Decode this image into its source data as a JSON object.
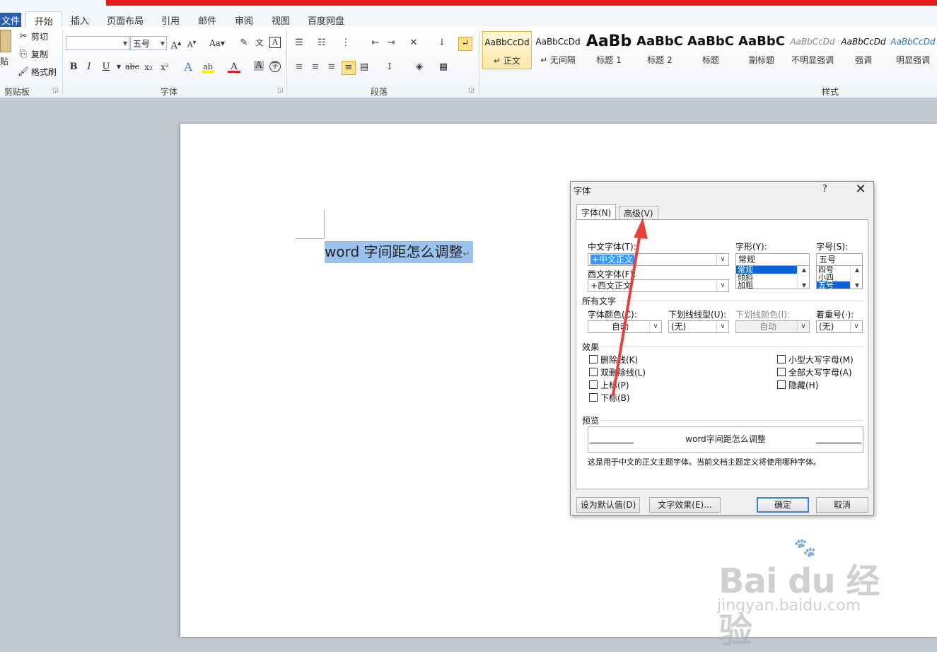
{
  "tabs": {
    "file": "文件",
    "items": [
      "开始",
      "插入",
      "页面布局",
      "引用",
      "邮件",
      "审阅",
      "视图",
      "百度网盘"
    ]
  },
  "ribbon": {
    "clipboard": {
      "paste": "贴",
      "cut": "剪切",
      "copy": "复制",
      "format_painter": "格式刷",
      "label": "剪贴板"
    },
    "font": {
      "font_name": "",
      "font_size": "五号",
      "label": "字体"
    },
    "paragraph": {
      "label": "段落"
    },
    "styles": {
      "label": "样式",
      "items": [
        {
          "sample": "AaBbCcDd",
          "name": "↵ 正文"
        },
        {
          "sample": "AaBbCcDd",
          "name": "↵ 无间隔"
        },
        {
          "sample": "AaBb",
          "name": "标题 1"
        },
        {
          "sample": "AaBbC",
          "name": "标题 2"
        },
        {
          "sample": "AaBbC",
          "name": "标题"
        },
        {
          "sample": "AaBbC",
          "name": "副标题"
        },
        {
          "sample": "AaBbCcDd",
          "name": "不明显强调"
        },
        {
          "sample": "AaBbCcDd",
          "name": "强调"
        },
        {
          "sample": "AaBbCcDd",
          "name": "明显强调"
        }
      ]
    }
  },
  "document": {
    "selected_text": "word 字间距怎么调整",
    "para_mark": "↵"
  },
  "dialog": {
    "title": "字体",
    "help": "?",
    "close": "✕",
    "tabs": [
      "字体(N)",
      "高级(V)"
    ],
    "cn_font_label": "中文字体(T):",
    "cn_font_value": "+中文正文",
    "west_font_label": "西文字体(F):",
    "west_font_value": "+西文正文",
    "style_label": "字形(Y):",
    "style_value": "常规",
    "style_list": [
      "常规",
      "倾斜",
      "加粗"
    ],
    "size_label": "字号(S):",
    "size_value": "五号",
    "size_list": [
      "四号",
      "小四",
      "五号"
    ],
    "all_text_label": "所有文字",
    "color_label": "字体颜色(C):",
    "color_value": "自动",
    "underline_label": "下划线线型(U):",
    "underline_value": "(无)",
    "underline_color_label": "下划线颜色(I):",
    "underline_color_value": "自动",
    "emphasis_label": "着重号(·):",
    "emphasis_value": "(无)",
    "effects_label": "效果",
    "effects_left": [
      "删除线(K)",
      "双删除线(L)",
      "上标(P)",
      "下标(B)"
    ],
    "effects_right": [
      "小型大写字母(M)",
      "全部大写字母(A)",
      "隐藏(H)"
    ],
    "preview_label": "预览",
    "preview_text": "word字间距怎么调整",
    "preview_note": "这是用于中文的正文主题字体。当前文档主题定义将使用哪种字体。",
    "btn_default": "设为默认值(D)",
    "btn_effects": "文字效果(E)...",
    "btn_ok": "确定",
    "btn_cancel": "取消"
  },
  "watermark": {
    "brand": "Bai du 经验",
    "url": "jingyan.baidu.com"
  },
  "colors": {
    "accent": "#2a5fb0",
    "selection": "#9bc2ee",
    "arrow": "#e8403a",
    "title_strip": "#e31b1b"
  }
}
